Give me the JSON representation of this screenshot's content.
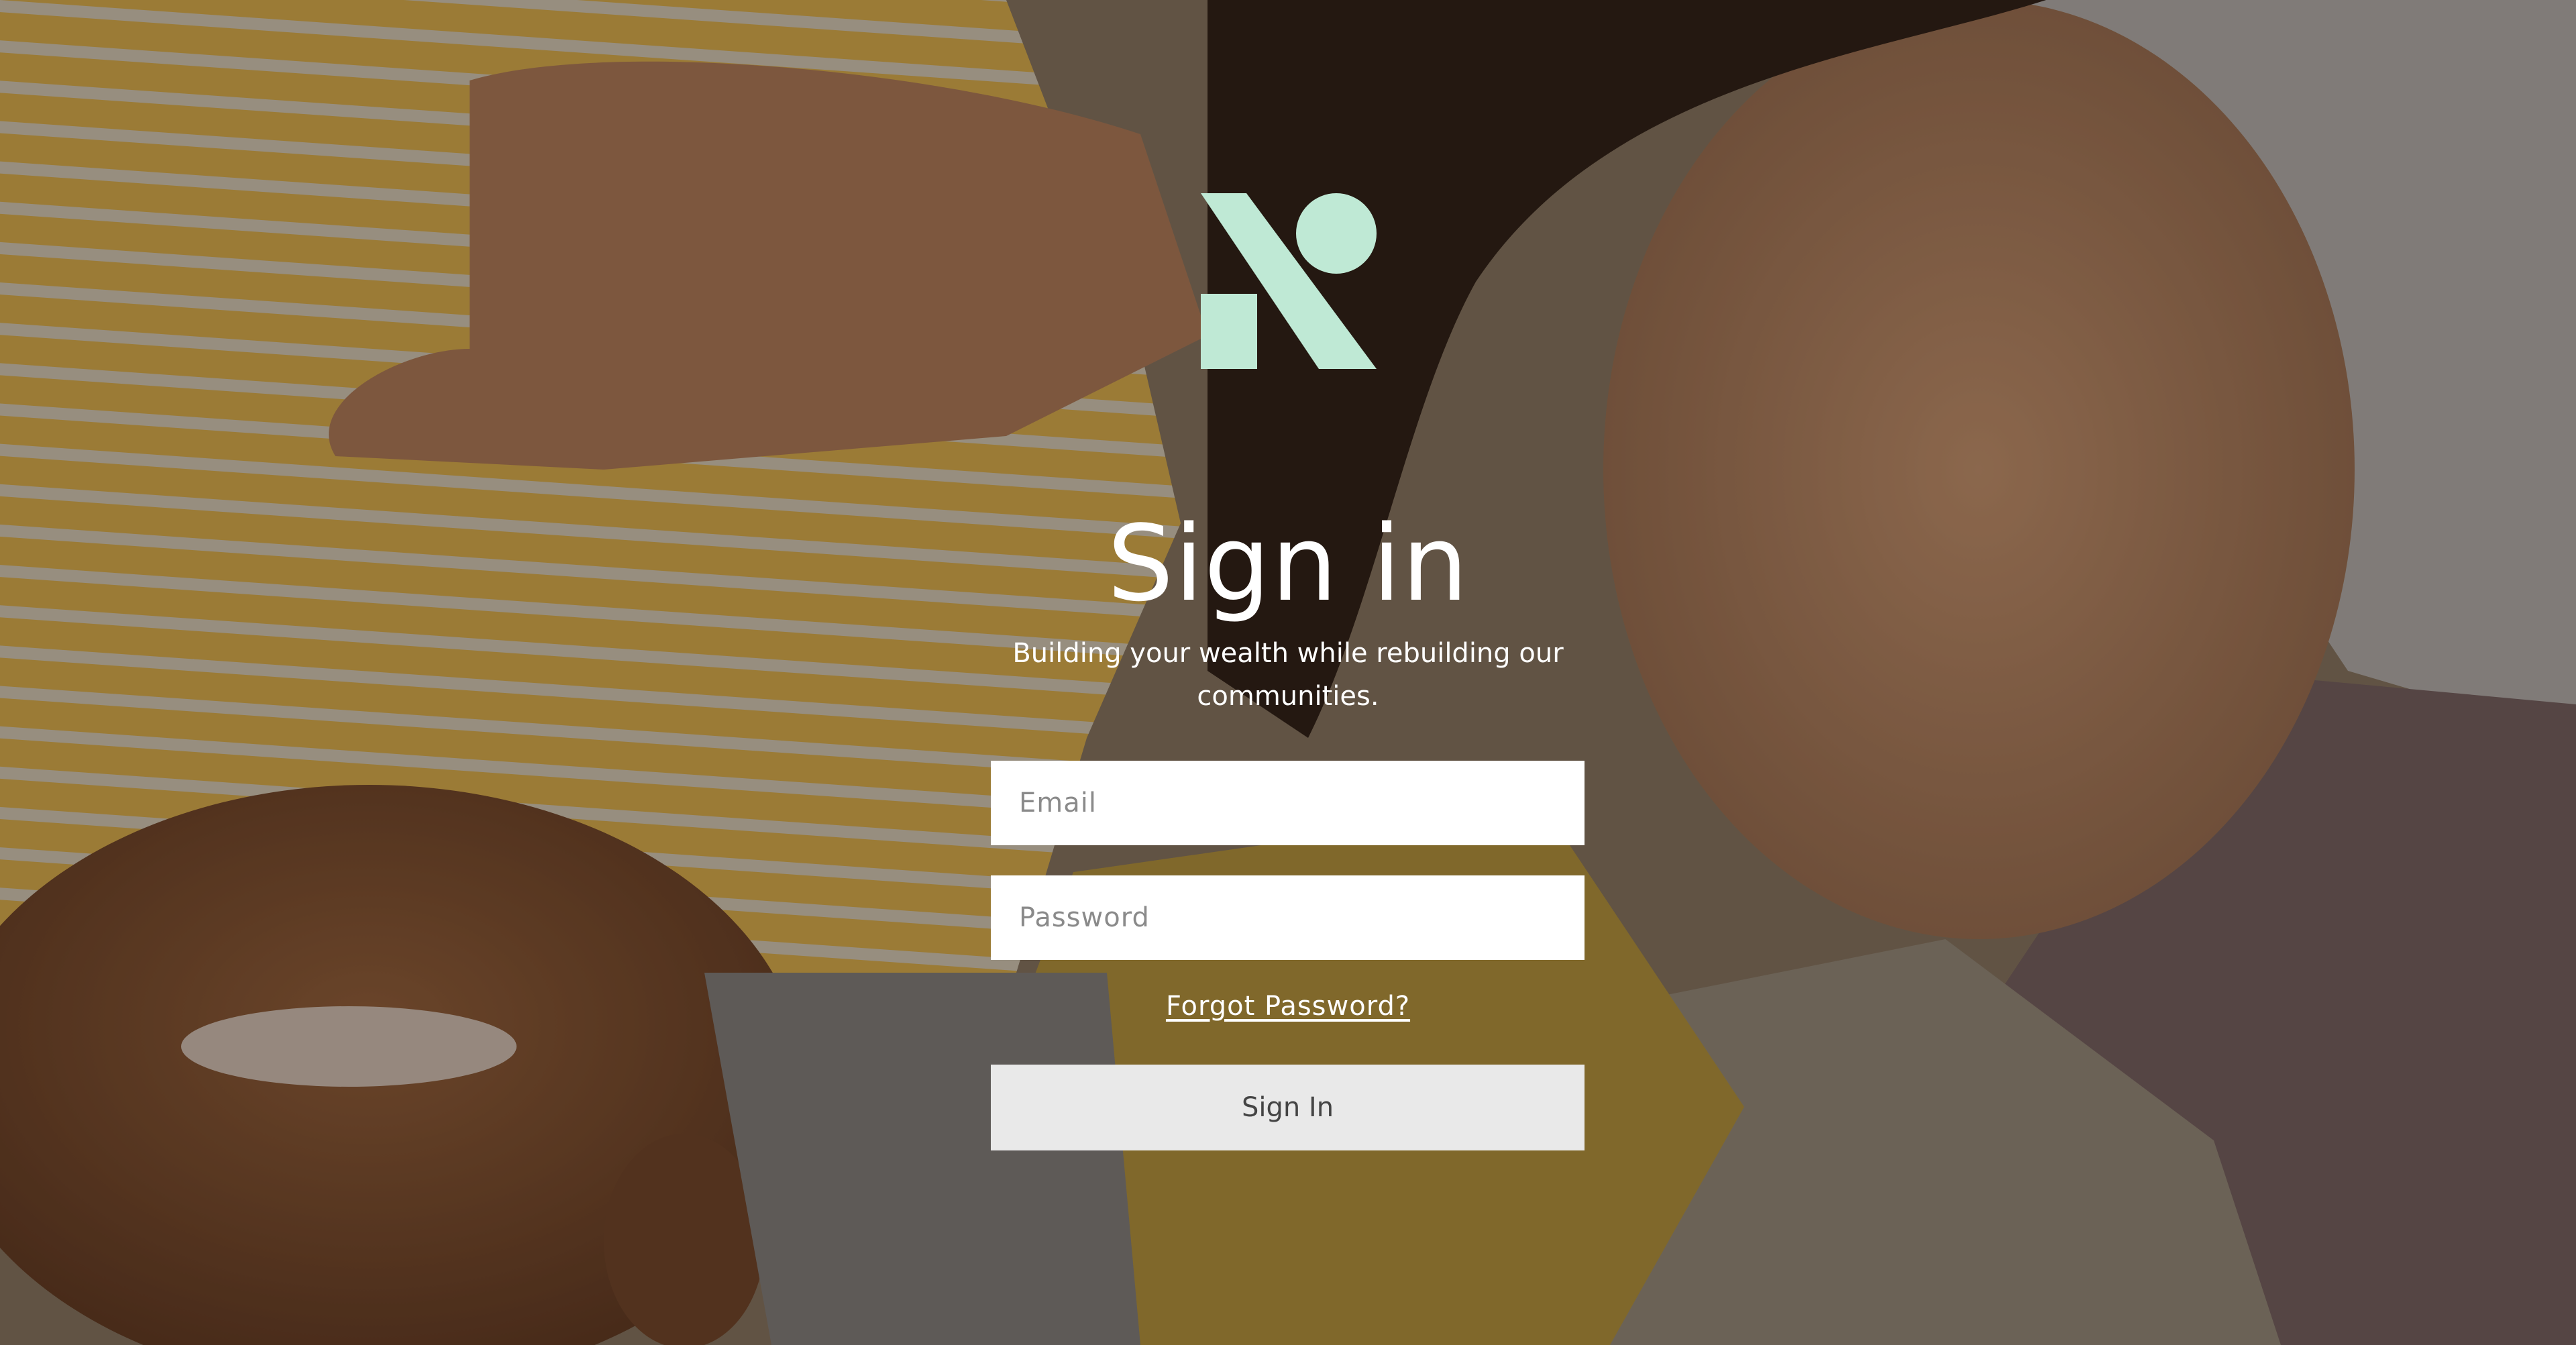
{
  "brand": {
    "logo_icon": "brand-logo-icon",
    "logo_color": "#bfe9d5"
  },
  "signin": {
    "title": "Sign in",
    "subtitle": "Building your wealth while rebuilding our communities.",
    "email": {
      "placeholder": "Email",
      "value": ""
    },
    "password": {
      "placeholder": "Password",
      "value": ""
    },
    "forgot_label": "Forgot Password?",
    "button_label": "Sign In"
  },
  "colors": {
    "accent": "#bfe9d5",
    "button_bg": "#e9e9e9",
    "text_light": "#ffffff"
  }
}
